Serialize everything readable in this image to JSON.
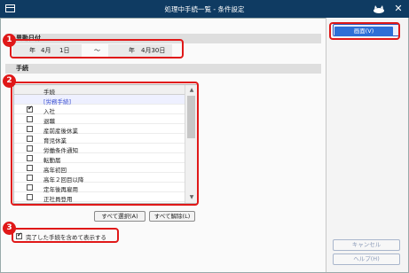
{
  "window": {
    "title": "処理中手続一覧 - 条件設定"
  },
  "sections": {
    "date": "異動日付",
    "procedures": "手続"
  },
  "date_range": {
    "from_year_suffix": "年",
    "from_month": "4月",
    "from_day": "1日",
    "separator": "～",
    "to_year_suffix": "年",
    "to_month_day": "4月30日"
  },
  "procedure_list": {
    "column_header": "手続",
    "rows": [
      {
        "label": "[労務手続]",
        "checked": false,
        "group": true
      },
      {
        "label": "入社",
        "checked": true
      },
      {
        "label": "退職",
        "checked": false
      },
      {
        "label": "産前産後休業",
        "checked": false
      },
      {
        "label": "育児休業",
        "checked": false
      },
      {
        "label": "労働条件通知",
        "checked": false
      },
      {
        "label": "転勤届",
        "checked": false
      },
      {
        "label": "高年初回",
        "checked": false
      },
      {
        "label": "高年２回目以降",
        "checked": false
      },
      {
        "label": "定年後再雇用",
        "checked": false
      },
      {
        "label": "正社員登用",
        "checked": false
      }
    ]
  },
  "buttons": {
    "select_all": "すべて選択(A)",
    "clear_all": "すべて解除(L)",
    "show": "画面(V)",
    "cancel": "キャンセル",
    "help": "ヘルプ(H)"
  },
  "include_completed": {
    "label": "完了した手続を含めて表示する",
    "checked": true
  },
  "callouts": [
    "1",
    "2",
    "3"
  ],
  "colors": {
    "titlebar": "#0f3b62",
    "callout": "#e01818",
    "primary_button": "#2e6fd6",
    "link": "#3a4fd0"
  }
}
